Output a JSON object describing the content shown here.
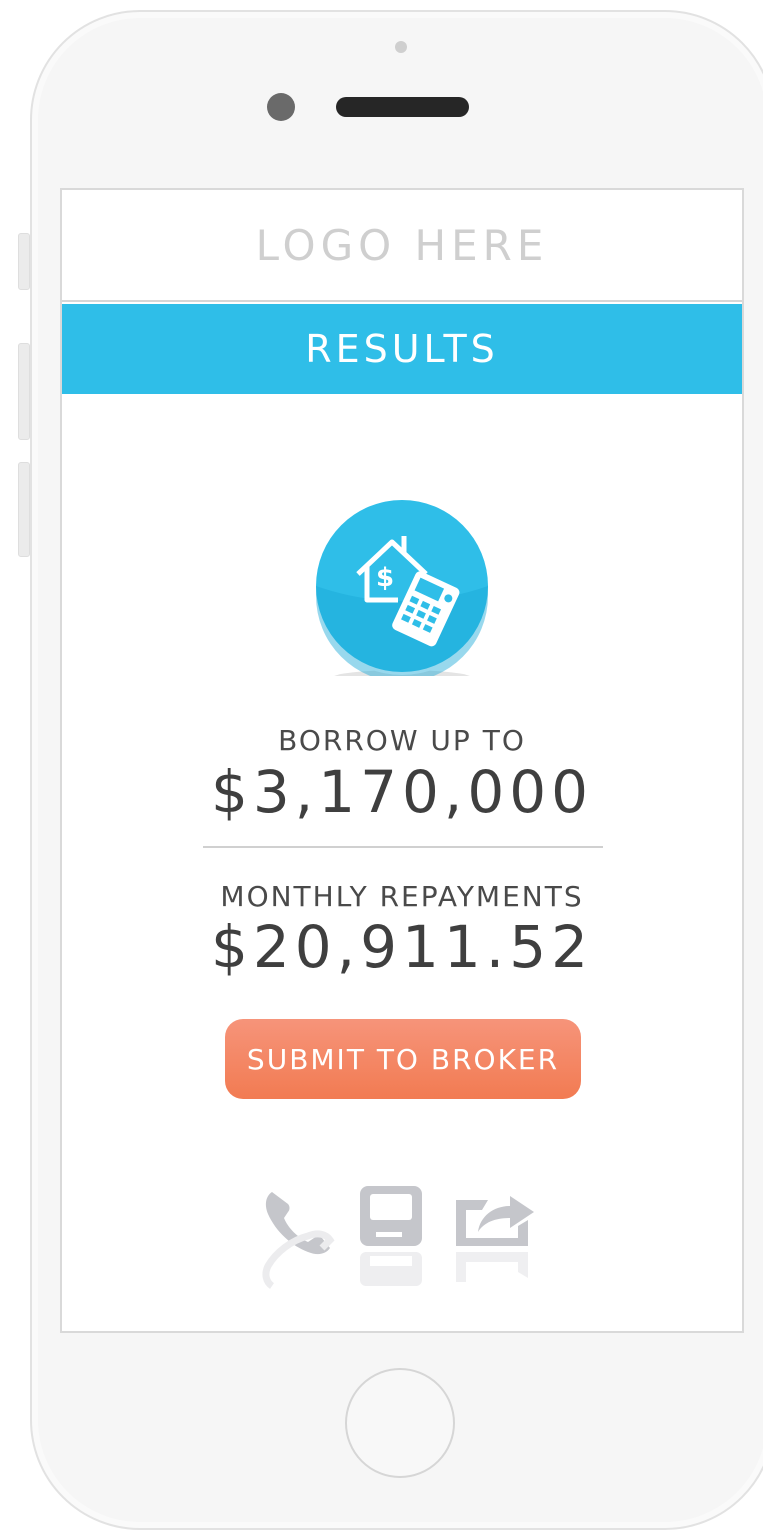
{
  "header": {
    "logo_text": "LOGO HERE"
  },
  "banner": {
    "title": "RESULTS"
  },
  "results": {
    "borrow_label": "BORROW UP TO",
    "borrow_amount": "$3,170,000",
    "monthly_label": "MONTHLY REPAYMENTS",
    "monthly_amount": "$20,911.52"
  },
  "actions": {
    "submit_label": "SUBMIT TO BROKER"
  },
  "icons": {
    "hero": "house-calculator-icon",
    "bottom": [
      "phone-icon",
      "save-icon",
      "share-icon"
    ]
  },
  "colors": {
    "accent_blue": "#2fbee8",
    "button_orange": "#f27b52",
    "icon_gray": "#c5c6cb"
  }
}
